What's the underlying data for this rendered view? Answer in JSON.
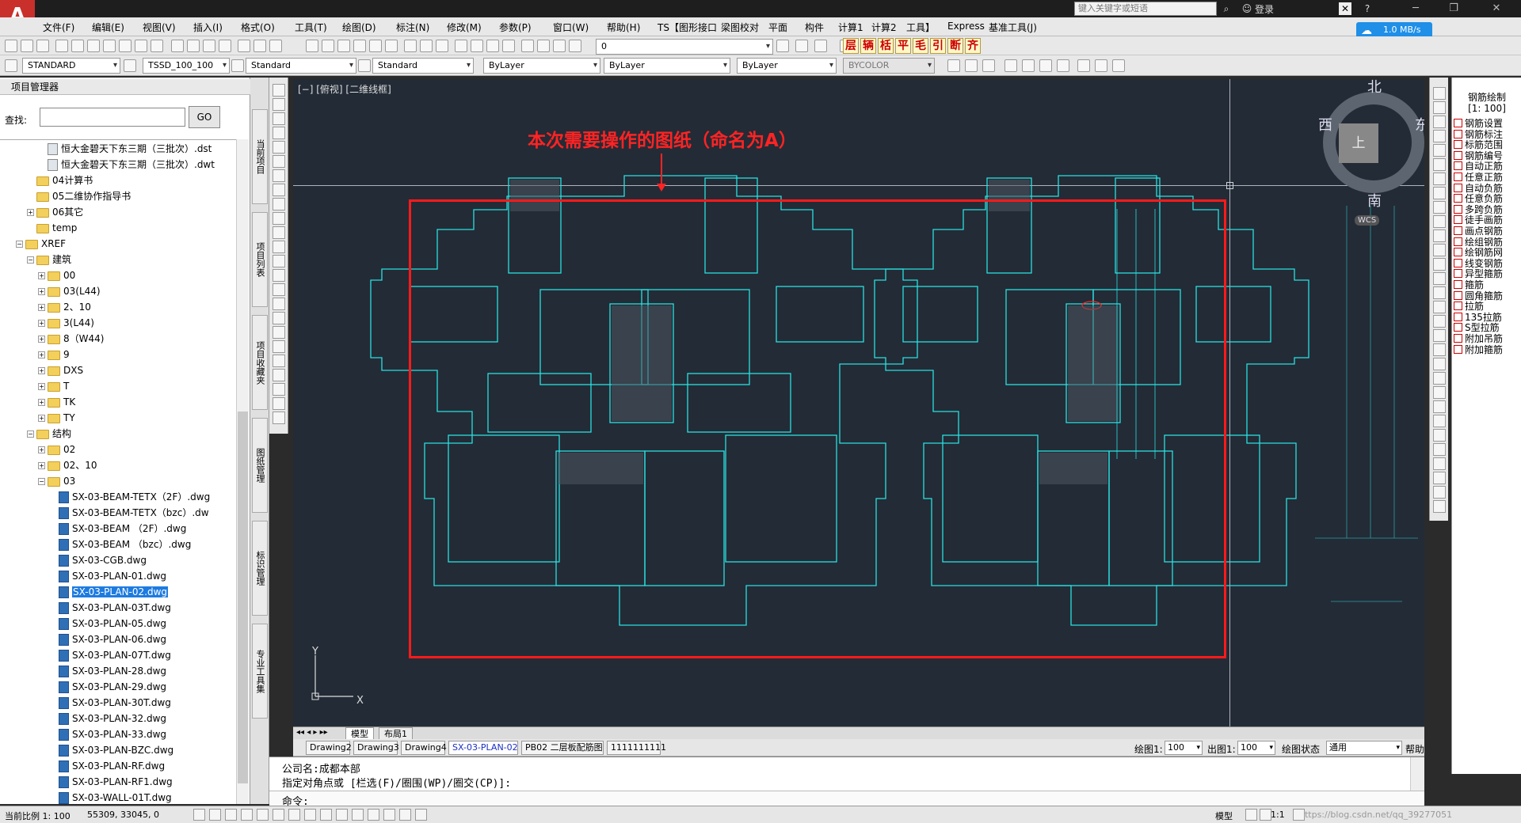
{
  "titlebar": {
    "search_placeholder": "键入关键字或短语",
    "login": "登录",
    "minimize": "─",
    "restore": "❐",
    "close": "✕"
  },
  "menu": [
    "文件(F)",
    "编辑(E)",
    "视图(V)",
    "插入(I)",
    "格式(O)",
    "工具(T)",
    "绘图(D)",
    "标注(N)",
    "修改(M)",
    "参数(P)",
    "窗口(W)",
    "帮助(H)",
    "TS【图形接口",
    "梁图校对",
    "平面",
    "构件",
    "计算1",
    "计算2",
    "工具】",
    "Express",
    "基准工具(J)"
  ],
  "speed_badge": "1.0 MB/s",
  "toolbar1": {
    "layer_value": "0"
  },
  "toolbar2": {
    "text_style": "STANDARD",
    "dim_style": "TSSD_100_100",
    "table_style": "Standard",
    "multileader_style": "Standard",
    "layer": "ByLayer",
    "linetype": "ByLayer",
    "lineweight": "ByLayer",
    "color": "BYCOLOR"
  },
  "tssd_buttons": [
    "层",
    "辆",
    "栝",
    "平",
    "毛",
    "引",
    "断",
    "齐"
  ],
  "project_panel": {
    "title": "项目管理器",
    "find_label": "查找:",
    "go_button": "GO",
    "tree": [
      {
        "label": "恒大金碧天下东三期（三批次）.dst",
        "indent": 4,
        "type": "file2",
        "expander": ""
      },
      {
        "label": "恒大金碧天下东三期（三批次）.dwt",
        "indent": 4,
        "type": "file2",
        "expander": ""
      },
      {
        "label": "04计算书",
        "indent": 3,
        "type": "folder",
        "expander": ""
      },
      {
        "label": "05二维协作指导书",
        "indent": 3,
        "type": "folder",
        "expander": ""
      },
      {
        "label": "06其它",
        "indent": 3,
        "type": "folder",
        "expander": "+"
      },
      {
        "label": "temp",
        "indent": 3,
        "type": "folder",
        "expander": ""
      },
      {
        "label": "XREF",
        "indent": 2,
        "type": "folder",
        "expander": "−"
      },
      {
        "label": "建筑",
        "indent": 3,
        "type": "folder",
        "expander": "−"
      },
      {
        "label": "00",
        "indent": 4,
        "type": "folder",
        "expander": "+"
      },
      {
        "label": "03(L44)",
        "indent": 4,
        "type": "folder",
        "expander": "+"
      },
      {
        "label": "2、10",
        "indent": 4,
        "type": "folder",
        "expander": "+"
      },
      {
        "label": "3(L44)",
        "indent": 4,
        "type": "folder",
        "expander": "+"
      },
      {
        "label": "8（W44)",
        "indent": 4,
        "type": "folder",
        "expander": "+"
      },
      {
        "label": "9",
        "indent": 4,
        "type": "folder",
        "expander": "+"
      },
      {
        "label": "DXS",
        "indent": 4,
        "type": "folder",
        "expander": "+"
      },
      {
        "label": "T",
        "indent": 4,
        "type": "folder",
        "expander": "+"
      },
      {
        "label": "TK",
        "indent": 4,
        "type": "folder",
        "expander": "+"
      },
      {
        "label": "TY",
        "indent": 4,
        "type": "folder",
        "expander": "+"
      },
      {
        "label": "结构",
        "indent": 3,
        "type": "folder",
        "expander": "−"
      },
      {
        "label": "02",
        "indent": 4,
        "type": "folder",
        "expander": "+"
      },
      {
        "label": "02、10",
        "indent": 4,
        "type": "folder",
        "expander": "+"
      },
      {
        "label": "03",
        "indent": 4,
        "type": "folder",
        "expander": "−"
      },
      {
        "label": "SX-03-BEAM-TETX（2F）.dwg",
        "indent": 5,
        "type": "file",
        "expander": ""
      },
      {
        "label": "SX-03-BEAM-TETX（bzc）.dw",
        "indent": 5,
        "type": "file",
        "expander": ""
      },
      {
        "label": "SX-03-BEAM （2F）.dwg",
        "indent": 5,
        "type": "file",
        "expander": ""
      },
      {
        "label": "SX-03-BEAM （bzc）.dwg",
        "indent": 5,
        "type": "file",
        "expander": ""
      },
      {
        "label": "SX-03-CGB.dwg",
        "indent": 5,
        "type": "file",
        "expander": ""
      },
      {
        "label": "SX-03-PLAN-01.dwg",
        "indent": 5,
        "type": "file",
        "expander": ""
      },
      {
        "label": "SX-03-PLAN-02.dwg",
        "indent": 5,
        "type": "file",
        "expander": "",
        "selected": true
      },
      {
        "label": "SX-03-PLAN-03T.dwg",
        "indent": 5,
        "type": "file",
        "expander": ""
      },
      {
        "label": "SX-03-PLAN-05.dwg",
        "indent": 5,
        "type": "file",
        "expander": ""
      },
      {
        "label": "SX-03-PLAN-06.dwg",
        "indent": 5,
        "type": "file",
        "expander": ""
      },
      {
        "label": "SX-03-PLAN-07T.dwg",
        "indent": 5,
        "type": "file",
        "expander": ""
      },
      {
        "label": "SX-03-PLAN-28.dwg",
        "indent": 5,
        "type": "file",
        "expander": ""
      },
      {
        "label": "SX-03-PLAN-29.dwg",
        "indent": 5,
        "type": "file",
        "expander": ""
      },
      {
        "label": "SX-03-PLAN-30T.dwg",
        "indent": 5,
        "type": "file",
        "expander": ""
      },
      {
        "label": "SX-03-PLAN-32.dwg",
        "indent": 5,
        "type": "file",
        "expander": ""
      },
      {
        "label": "SX-03-PLAN-33.dwg",
        "indent": 5,
        "type": "file",
        "expander": ""
      },
      {
        "label": "SX-03-PLAN-BZC.dwg",
        "indent": 5,
        "type": "file",
        "expander": ""
      },
      {
        "label": "SX-03-PLAN-RF.dwg",
        "indent": 5,
        "type": "file",
        "expander": ""
      },
      {
        "label": "SX-03-PLAN-RF1.dwg",
        "indent": 5,
        "type": "file",
        "expander": ""
      },
      {
        "label": "SX-03-WALL-01T.dwg",
        "indent": 5,
        "type": "file",
        "expander": ""
      }
    ]
  },
  "vertical_tabs": [
    "当前项目",
    "项目列表",
    "项目收藏夹",
    "图纸管理",
    "标识管理",
    "专业工具集"
  ],
  "viewport": {
    "label": "[−] [俯视] [二维线框]",
    "annotation": "本次需要操作的图纸（命名为A）",
    "compass": {
      "north": "北",
      "south": "南",
      "east": "东",
      "west": "西",
      "top": "上",
      "wcs": "WCS"
    },
    "ucs_x": "X",
    "ucs_y": "Y"
  },
  "layout_tabs": [
    "模型",
    "布局1"
  ],
  "drawing_tabs": {
    "tabs": [
      "Drawing2",
      "Drawing3",
      "Drawing4",
      "SX-03-PLAN-02",
      "PB02 二层板配筋图",
      "1111111111"
    ],
    "active": "SX-03-PLAN-02",
    "scale1_label": "绘图1:",
    "scale1_value": "100",
    "scale2_label": "出图1:",
    "scale2_value": "100",
    "state_label": "绘图状态",
    "state_value": "通用",
    "help": "帮助"
  },
  "command": {
    "line1": "公司名:成都本部",
    "line2": "指定对角点或 [栏选(F)/圈围(WP)/圈交(CP)]:",
    "prompt": "命令:"
  },
  "status": {
    "scale": "当前比例 1: 100",
    "coords": "55309, 33045, 0",
    "model": "模型",
    "scale_right": "1:1",
    "watermark": "https://blog.csdn.net/qq_39277051"
  },
  "rebar_panel": {
    "title": "钢筋绘制",
    "scale": "[1: 100]",
    "items": [
      "钢筋设置",
      "钢筋标注",
      "标筋范围",
      "钢筋编号",
      "自动正筋",
      "任意正筋",
      "自动负筋",
      "任意负筋",
      "多跨负筋",
      "徒手画筋",
      "画点钢筋",
      "绘组钢筋",
      "绘钢筋网",
      "线变钢筋",
      "异型箍筋",
      "箍筋",
      "圆角箍筋",
      "拉筋",
      "135拉筋",
      "S型拉筋",
      "附加吊筋",
      "附加箍筋"
    ]
  },
  "colors": {
    "accent": "#1e7be0",
    "annotation_red": "#ff1a1a",
    "viewport_bg": "#232b36",
    "cad_cyan": "#28e0e0"
  }
}
